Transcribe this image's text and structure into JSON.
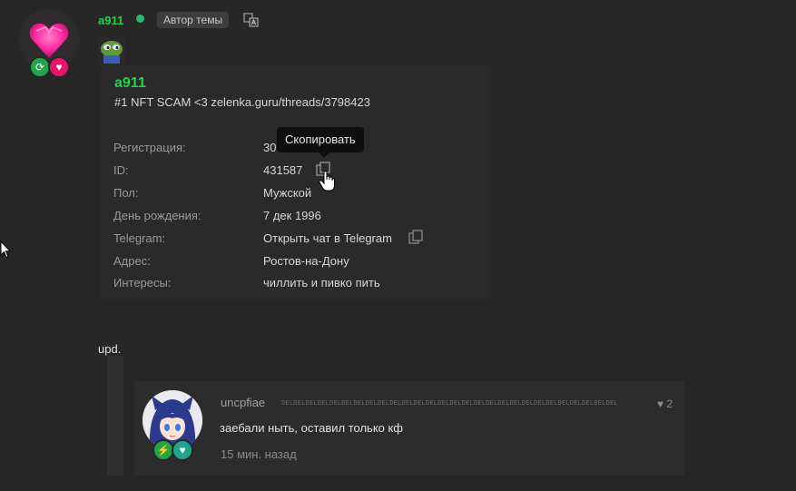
{
  "post": {
    "username": "a911",
    "author_badge": "Автор темы",
    "icons": {
      "online": "online-dot",
      "translate": "translate-icon",
      "avatar_badges": [
        "refresh-badge-icon",
        "heart-badge-icon"
      ]
    }
  },
  "profile_card": {
    "name": "a911",
    "status": "#1 NFT SCAM <3 zelenka.guru/threads/3798423",
    "rows": [
      {
        "label": "Регистрация:",
        "value": "30"
      },
      {
        "label": "ID:",
        "value": "431587"
      },
      {
        "label": "Пол:",
        "value": "Мужской"
      },
      {
        "label": "День рождения:",
        "value": "7 дек 1996"
      },
      {
        "label": "Telegram:",
        "value": "Открыть чат в Telegram"
      },
      {
        "label": "Адрес:",
        "value": "Ростов-на-Дону"
      },
      {
        "label": "Интересы:",
        "value": "чиллить и пивко пить"
      }
    ],
    "tooltip": "Скопировать"
  },
  "body": {
    "text": "upd."
  },
  "comment": {
    "username": "uncpfiae",
    "strip": "DELDELDELDELDELDELDELDELDELDELDELDELDELDELDELDELDELDELDELDELDELDELDELDELDELDELDELDEL",
    "likes": "2",
    "text": "заебали ныть, оставил только кф",
    "time": "15 мин. назад"
  },
  "colors": {
    "background": "#272727",
    "username_green": "#22d34a",
    "online_dot": "#2cb86b",
    "badge_pink": "#e8156b",
    "badge_green": "#1fa64a"
  }
}
